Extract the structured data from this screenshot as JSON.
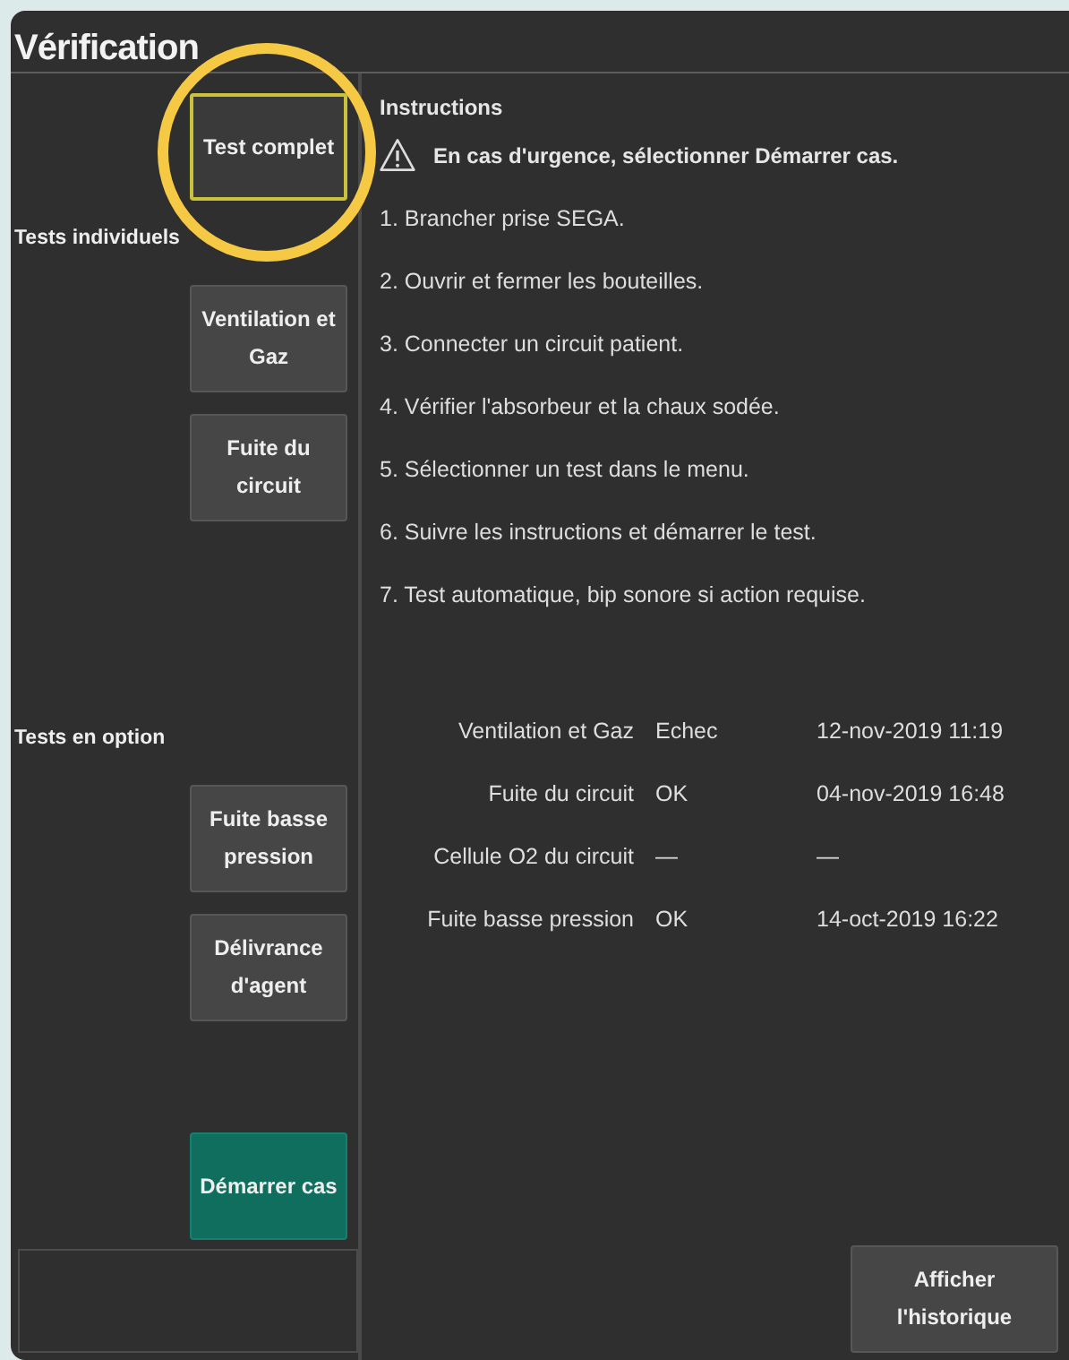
{
  "window": {
    "title": "Vérification"
  },
  "top_button": {
    "label": "Test complet",
    "selected": true
  },
  "sections": [
    {
      "heading": "Tests individuels",
      "buttons": [
        {
          "label": "Ventilation et Gaz",
          "selected": false
        },
        {
          "label": "Fuite du circuit",
          "selected": false
        }
      ]
    },
    {
      "heading": "Tests en option",
      "buttons": [
        {
          "label": "Fuite basse pression",
          "selected": false
        },
        {
          "label": "Délivrance d'agent",
          "selected": false
        }
      ]
    }
  ],
  "start_button": {
    "label": "Démarrer cas"
  },
  "instructions": {
    "heading": "Instructions",
    "warning": "En cas d'urgence, sélectionner Démarrer cas.",
    "steps": [
      "1. Brancher prise SEGA.",
      "2. Ouvrir et fermer les bouteilles.",
      "3. Connecter un circuit patient.",
      "4. Vérifier l'absorbeur et la chaux sodée.",
      "5. Sélectionner un test dans le menu.",
      "6. Suivre les instructions et démarrer le test.",
      "7. Test automatique, bip sonore si action requise."
    ]
  },
  "results": [
    {
      "test": "Ventilation et Gaz",
      "status": "Echec",
      "date": "12-nov-2019 11:19"
    },
    {
      "test": "Fuite du circuit",
      "status": "OK",
      "date": "04-nov-2019 16:48"
    },
    {
      "test": "Cellule O2 du circuit",
      "status": "—",
      "date": "—"
    },
    {
      "test": "Fuite basse pression",
      "status": "OK",
      "date": "14-oct-2019 16:22"
    }
  ],
  "history_button": {
    "label": "Afficher l'historique"
  }
}
